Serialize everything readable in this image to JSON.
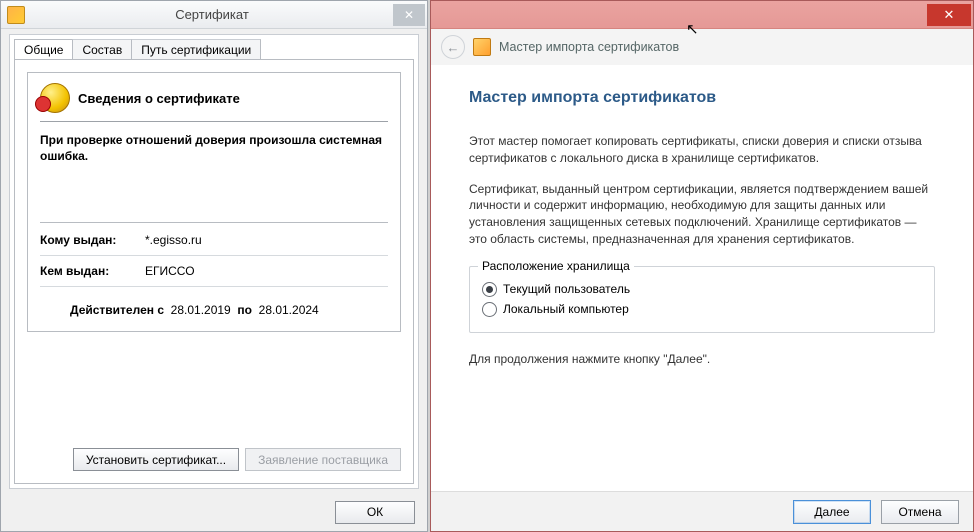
{
  "left": {
    "title": "Сертификат",
    "tabs": [
      {
        "label": "Общие"
      },
      {
        "label": "Состав"
      },
      {
        "label": "Путь сертификации"
      }
    ],
    "info_heading": "Сведения о сертификате",
    "error_message": "При проверке отношений доверия произошла системная ошибка.",
    "issued_to_label": "Кому выдан:",
    "issued_to_value": "*.egisso.ru",
    "issued_by_label": "Кем выдан:",
    "issued_by_value": "ЕГИССО",
    "valid_from_label": "Действителен с",
    "valid_from_value": "28.01.2019",
    "valid_to_label": "по",
    "valid_to_value": "28.01.2024",
    "install_btn": "Установить сертификат...",
    "vendor_btn": "Заявление поставщика",
    "ok_btn": "ОК"
  },
  "right": {
    "ribbon_title": "Мастер импорта сертификатов",
    "heading": "Мастер импорта сертификатов",
    "para1": "Этот мастер помогает копировать сертификаты, списки доверия и списки отзыва сертификатов с локального диска в хранилище сертификатов.",
    "para2": "Сертификат, выданный центром сертификации, является подтверждением вашей личности и содержит информацию, необходимую для защиты данных или установления защищенных сетевых подключений. Хранилище сертификатов — это область системы, предназначенная для хранения сертификатов.",
    "group_legend": "Расположение хранилища",
    "radio_current": "Текущий пользователь",
    "radio_local": "Локальный компьютер",
    "continue_hint": "Для продолжения нажмите кнопку \"Далее\".",
    "next_btn": "Далее",
    "cancel_btn": "Отмена"
  }
}
